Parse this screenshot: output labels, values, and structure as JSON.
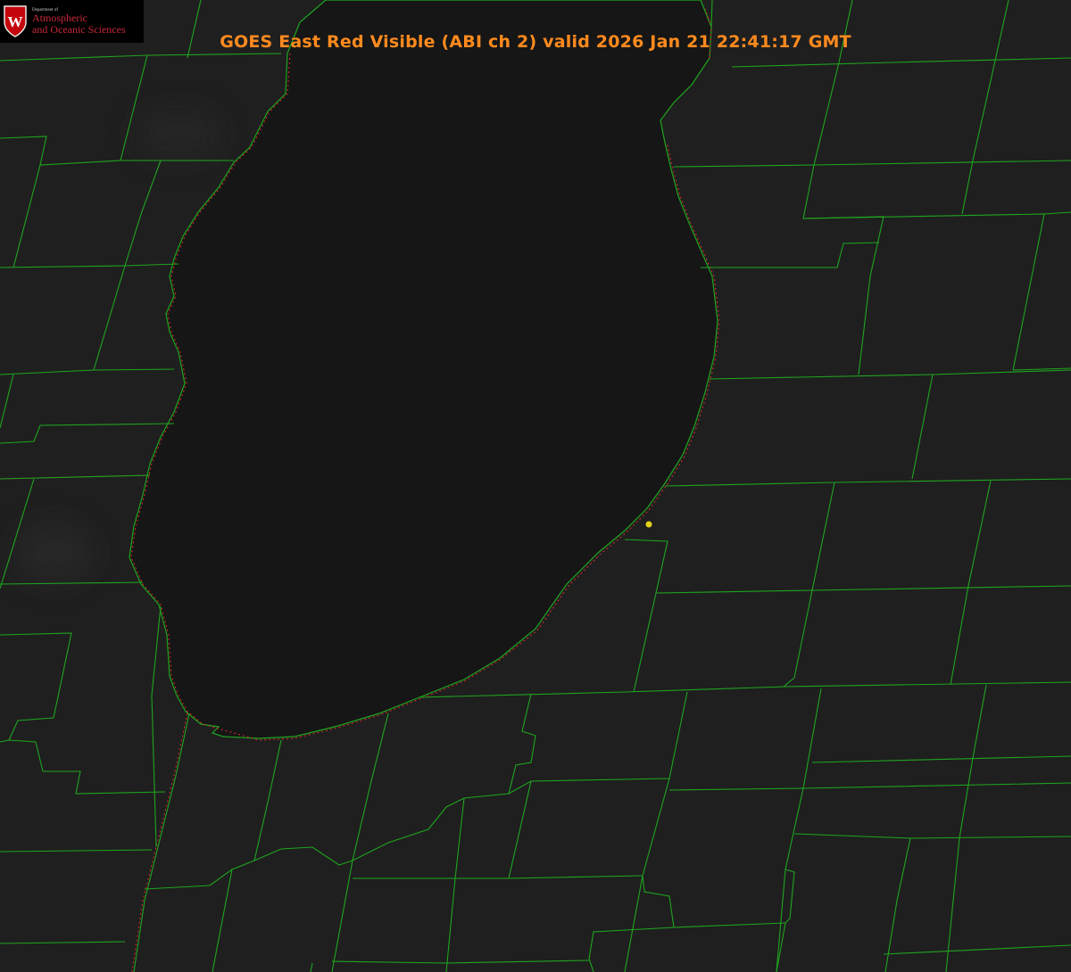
{
  "title": "GOES East Red Visible (ABI ch 2) valid 2026 Jan 21 22:41:17 GMT",
  "logo": {
    "shield_letter": "W",
    "department_line": "Department of",
    "line1": "Atmospheric",
    "line2": "and Oceanic Sciences"
  },
  "colors": {
    "background": "#1d1d1d",
    "lake": "#151515",
    "county_lines": "#1fa51f",
    "state_lines": "#d02a2a",
    "title": "#ff8a1e",
    "station_marker": "#e6d21a"
  },
  "icons": {
    "logo": "uw-shield-icon",
    "station": "station-dot-icon"
  }
}
